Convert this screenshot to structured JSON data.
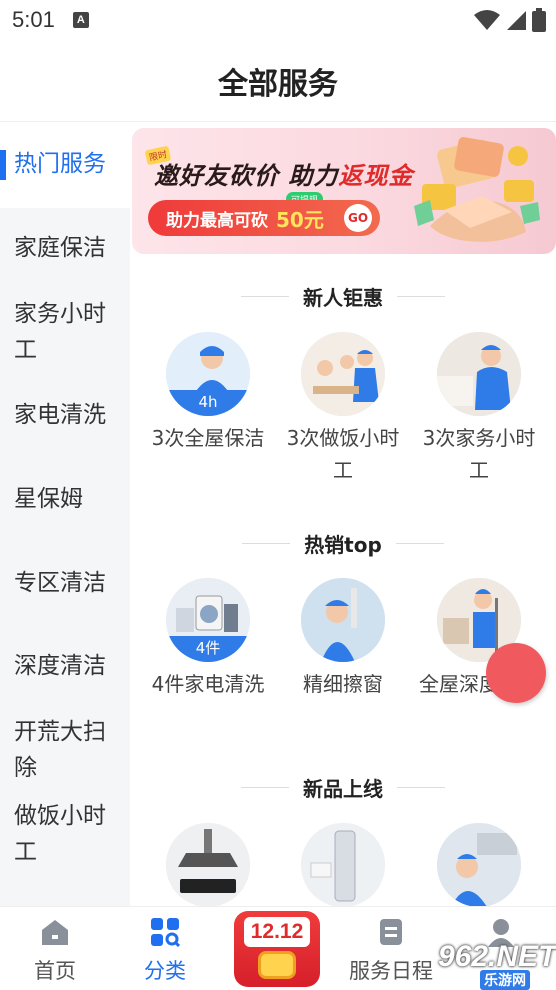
{
  "status_bar": {
    "time": "5:01",
    "notification_letter": "A"
  },
  "header": {
    "title": "全部服务"
  },
  "sidebar": {
    "items": [
      {
        "label": "热门服务",
        "active": true
      },
      {
        "label": "家庭保洁"
      },
      {
        "label": "家务小时工"
      },
      {
        "label": "家电清洗"
      },
      {
        "label": "星保姆"
      },
      {
        "label": "专区清洁"
      },
      {
        "label": "深度清洁"
      },
      {
        "label": "开荒大扫除"
      },
      {
        "label": "做饭小时工"
      }
    ]
  },
  "banner": {
    "tag": "限时",
    "title_part1": "邀好友砍价 助力",
    "title_part2": "返现金",
    "pill_text": "助力最高可砍",
    "pill_amount": "50元",
    "withdraw_tag": "可提现",
    "go_label": "GO"
  },
  "sections": [
    {
      "title": "新人钜惠",
      "items": [
        {
          "label": "3次全屋保洁",
          "badge": "4h",
          "icon": "cleaner-photo"
        },
        {
          "label": "3次做饭小时工",
          "icon": "family-dining-photo"
        },
        {
          "label": "3次家务小时工",
          "icon": "housekeeper-photo"
        }
      ]
    },
    {
      "title": "热销top",
      "items": [
        {
          "label": "4件家电清洗",
          "badge": "4件",
          "icon": "appliances-photo"
        },
        {
          "label": "精细擦窗",
          "icon": "window-cleaning-photo"
        },
        {
          "label": "全屋深度扫除",
          "icon": "deep-cleaning-photo"
        }
      ]
    },
    {
      "title": "新品上线",
      "items": [
        {
          "label": "",
          "icon": "range-hood-photo"
        },
        {
          "label": "",
          "icon": "air-conditioner-photo"
        },
        {
          "label": "",
          "icon": "ceiling-cleaning-photo"
        }
      ]
    }
  ],
  "bottom_nav": {
    "items": [
      {
        "label": "首页",
        "icon": "home-icon"
      },
      {
        "label": "分类",
        "icon": "category-icon",
        "active": true
      },
      {
        "label": "服务日程",
        "icon": "schedule-icon"
      },
      {
        "label": "",
        "icon": "profile-icon"
      }
    ],
    "promo_label": "12.12"
  },
  "watermark": {
    "text": "962.NET",
    "sub": "乐游网"
  },
  "colors": {
    "accent": "#1f6ff0",
    "badge": "#2f7be8",
    "banner_red": "#e02b2b"
  }
}
